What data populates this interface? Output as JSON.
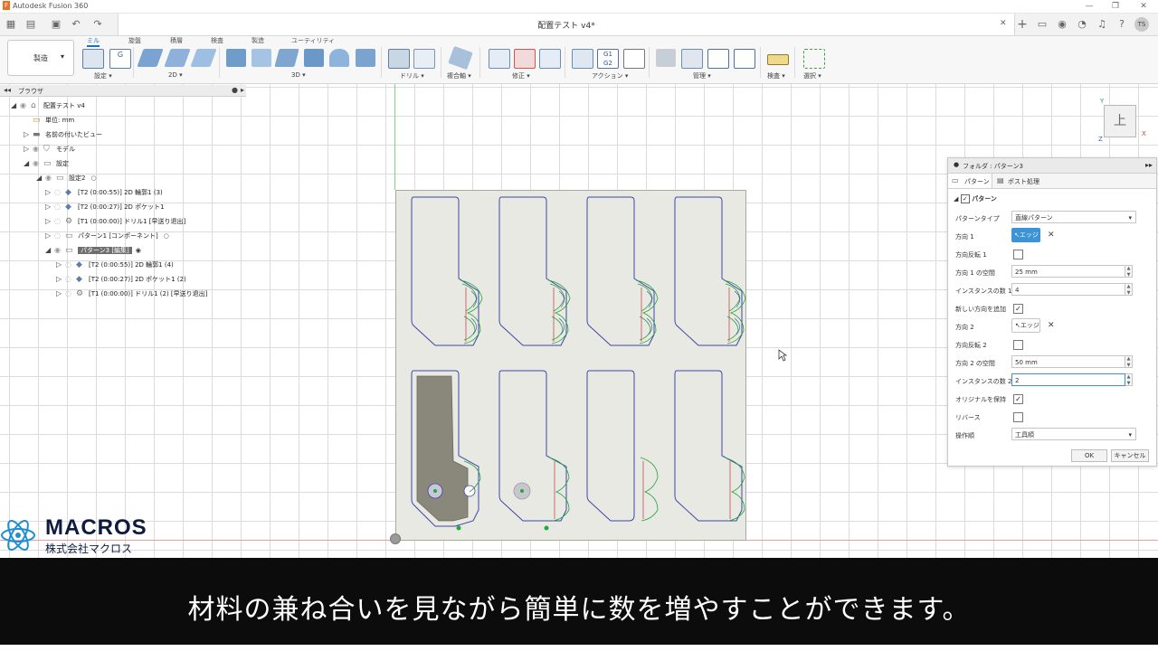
{
  "app": {
    "title": "Autodesk Fusion 360"
  },
  "document": {
    "name": "配置テスト v4*"
  },
  "user_initials": "TS",
  "ribbon": {
    "workspace": "製造",
    "tabs": [
      "ミル",
      "旋盤",
      "積層",
      "検査",
      "製造",
      "ユーティリティ"
    ],
    "groups": [
      "設定",
      "2D",
      "3D",
      "ドリル",
      "複合軸",
      "修正",
      "アクション",
      "管理",
      "検査",
      "選択"
    ]
  },
  "browser": {
    "title": "ブラウザ",
    "items": [
      {
        "label": "配置テスト v4",
        "indent": 0
      },
      {
        "label": "単位: mm",
        "indent": 1
      },
      {
        "label": "名前の付いたビュー",
        "indent": 1
      },
      {
        "label": "モデル",
        "indent": 1
      },
      {
        "label": "設定",
        "indent": 1
      },
      {
        "label": "設定2",
        "indent": 2
      },
      {
        "label": "[T2 (0:00:55)] 2D 輪郭1 (3)",
        "indent": 3
      },
      {
        "label": "[T2 (0:00:27)] 2D ポケット1",
        "indent": 3
      },
      {
        "label": "[T1 (0:00:00)] ドリル1 [早送り退出]",
        "indent": 3
      },
      {
        "label": "パターン1 [コンポーネント]",
        "indent": 3
      },
      {
        "label": "パターン3 [編集]",
        "indent": 3
      },
      {
        "label": "[T2 (0:00:55)] 2D 輪郭1 (4)",
        "indent": 4
      },
      {
        "label": "[T2 (0:00:27)] 2D ポケット1 (2)",
        "indent": 4
      },
      {
        "label": "[T1 (0:00:00)] ドリル1 (2) [早送り退出]",
        "indent": 4
      }
    ]
  },
  "viewcube": {
    "face": "上",
    "axis_x": "X",
    "axis_y": "Y",
    "axis_z": "Z"
  },
  "dialog": {
    "title": "フォルダ : パターン3",
    "tabs": [
      "パターン",
      "ポスト処理"
    ],
    "section": "パターン",
    "fields": {
      "pattern_type_label": "パターンタイプ",
      "pattern_type_value": "直線パターン",
      "dir1_label": "方向 1",
      "dir1_value": "エッジ",
      "flip1_label": "方向反転 1",
      "spacing1_label": "方向 1 の空間",
      "spacing1_value": "25 mm",
      "count1_label": "インスタンスの数 1",
      "count1_value": "4",
      "add_dir_label": "新しい方向を追加",
      "dir2_label": "方向 2",
      "dir2_value": "エッジ",
      "flip2_label": "方向反転 2",
      "spacing2_label": "方向 2 の空間",
      "spacing2_value": "50 mm",
      "count2_label": "インスタンスの数 2",
      "count2_value": "2",
      "keep_original_label": "オリジナルを保持",
      "reverse_label": "リバース",
      "operation_order_label": "操作順",
      "operation_order_value": "工具順"
    },
    "checks": {
      "flip1": false,
      "add_dir": true,
      "flip2": false,
      "keep_original": true,
      "reverse": false
    },
    "ok_label": "OK",
    "cancel_label": "キャンセル"
  },
  "logo": {
    "name": "MACROS",
    "company": "株式会社マクロス"
  },
  "subtitle": "材料の兼ね合いを見ながら簡単に数を増やすことができます。",
  "colors": {
    "accent": "#1c6fbf",
    "toolpath": "#3f46a5",
    "stock": "#e9e9e3",
    "cut": "#8a887a",
    "subtitle_bg": "#0c0c0c"
  }
}
